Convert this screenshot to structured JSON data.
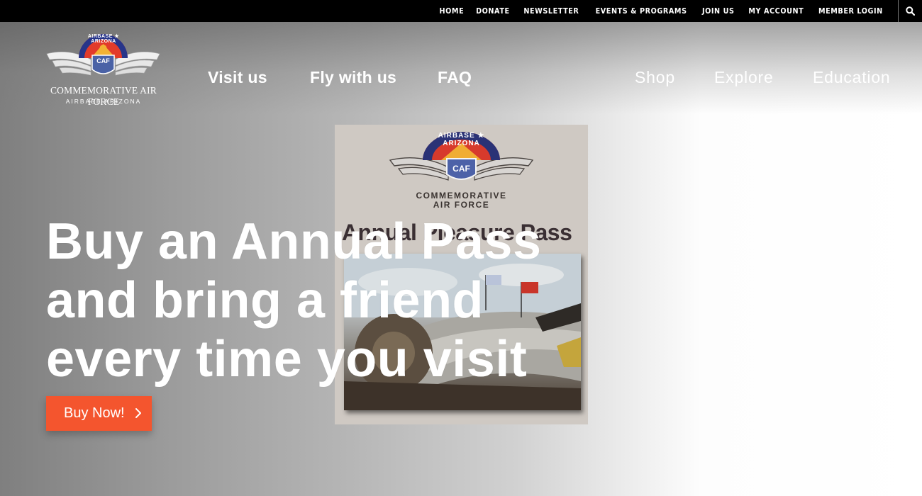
{
  "topbar": {
    "links": [
      "HOME",
      "DONATE",
      "NEWSLETTER",
      "EVENTS & PROGRAMS",
      "JOIN US",
      "MY ACCOUNT",
      "MEMBER LOGIN"
    ],
    "search_icon": "search-icon"
  },
  "logo": {
    "arc_text": "AIRBASE ★ ARIZONA",
    "badge": "CAF",
    "title": "COMMEMORATIVE AIR FORCE",
    "subtitle": "AIRBASE ARIZONA"
  },
  "nav": {
    "left": [
      "Visit us",
      "Fly with us",
      "FAQ"
    ],
    "right": [
      "Shop",
      "Explore",
      "Education"
    ]
  },
  "poster": {
    "arc_text": "AIRBASE ★ ARIZONA",
    "badge": "CAF",
    "logo_title": "COMMEMORATIVE",
    "logo_sub": "AIR FORCE",
    "title": "Annual Pleasure Pass"
  },
  "hero": {
    "headline_lines": [
      "Buy an Annual Pass",
      "and bring a friend",
      "every time you visit"
    ],
    "cta_label": "Buy Now!",
    "cta_icon": "chevron-right-icon"
  },
  "colors": {
    "topbar_bg": "#000000",
    "cta": "#f4552e",
    "text_on_hero": "#ffffff"
  }
}
